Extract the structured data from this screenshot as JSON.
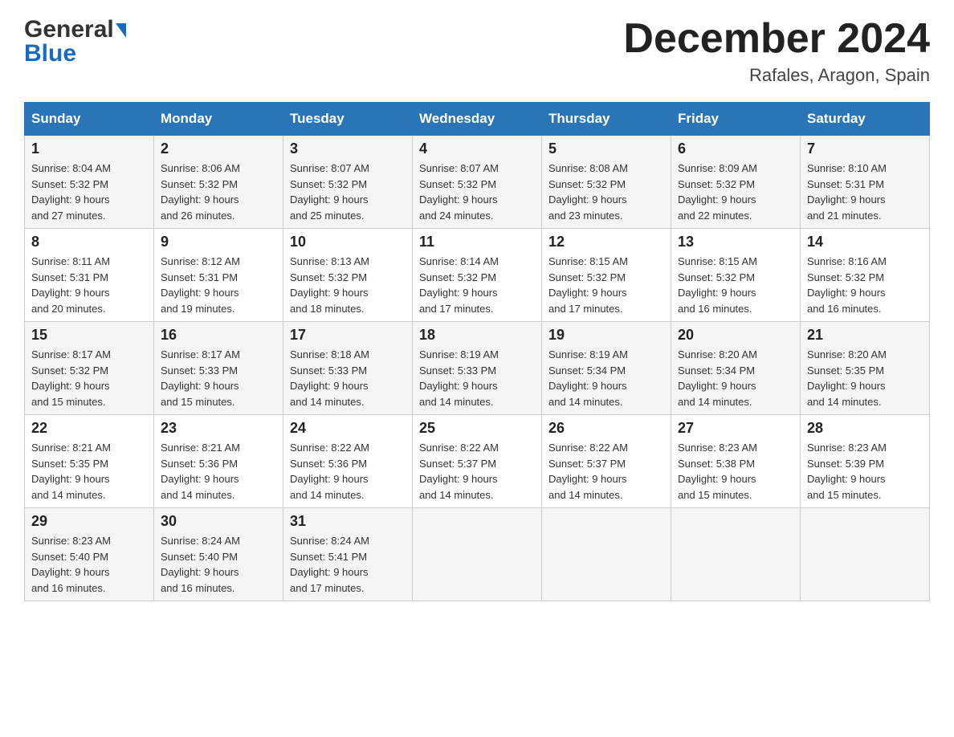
{
  "header": {
    "month_title": "December 2024",
    "location": "Rafales, Aragon, Spain",
    "logo_general": "General",
    "logo_blue": "Blue"
  },
  "days_of_week": [
    "Sunday",
    "Monday",
    "Tuesday",
    "Wednesday",
    "Thursday",
    "Friday",
    "Saturday"
  ],
  "weeks": [
    [
      {
        "day": "1",
        "sunrise": "8:04 AM",
        "sunset": "5:32 PM",
        "daylight": "9 hours and 27 minutes."
      },
      {
        "day": "2",
        "sunrise": "8:06 AM",
        "sunset": "5:32 PM",
        "daylight": "9 hours and 26 minutes."
      },
      {
        "day": "3",
        "sunrise": "8:07 AM",
        "sunset": "5:32 PM",
        "daylight": "9 hours and 25 minutes."
      },
      {
        "day": "4",
        "sunrise": "8:07 AM",
        "sunset": "5:32 PM",
        "daylight": "9 hours and 24 minutes."
      },
      {
        "day": "5",
        "sunrise": "8:08 AM",
        "sunset": "5:32 PM",
        "daylight": "9 hours and 23 minutes."
      },
      {
        "day": "6",
        "sunrise": "8:09 AM",
        "sunset": "5:32 PM",
        "daylight": "9 hours and 22 minutes."
      },
      {
        "day": "7",
        "sunrise": "8:10 AM",
        "sunset": "5:31 PM",
        "daylight": "9 hours and 21 minutes."
      }
    ],
    [
      {
        "day": "8",
        "sunrise": "8:11 AM",
        "sunset": "5:31 PM",
        "daylight": "9 hours and 20 minutes."
      },
      {
        "day": "9",
        "sunrise": "8:12 AM",
        "sunset": "5:31 PM",
        "daylight": "9 hours and 19 minutes."
      },
      {
        "day": "10",
        "sunrise": "8:13 AM",
        "sunset": "5:32 PM",
        "daylight": "9 hours and 18 minutes."
      },
      {
        "day": "11",
        "sunrise": "8:14 AM",
        "sunset": "5:32 PM",
        "daylight": "9 hours and 17 minutes."
      },
      {
        "day": "12",
        "sunrise": "8:15 AM",
        "sunset": "5:32 PM",
        "daylight": "9 hours and 17 minutes."
      },
      {
        "day": "13",
        "sunrise": "8:15 AM",
        "sunset": "5:32 PM",
        "daylight": "9 hours and 16 minutes."
      },
      {
        "day": "14",
        "sunrise": "8:16 AM",
        "sunset": "5:32 PM",
        "daylight": "9 hours and 16 minutes."
      }
    ],
    [
      {
        "day": "15",
        "sunrise": "8:17 AM",
        "sunset": "5:32 PM",
        "daylight": "9 hours and 15 minutes."
      },
      {
        "day": "16",
        "sunrise": "8:17 AM",
        "sunset": "5:33 PM",
        "daylight": "9 hours and 15 minutes."
      },
      {
        "day": "17",
        "sunrise": "8:18 AM",
        "sunset": "5:33 PM",
        "daylight": "9 hours and 14 minutes."
      },
      {
        "day": "18",
        "sunrise": "8:19 AM",
        "sunset": "5:33 PM",
        "daylight": "9 hours and 14 minutes."
      },
      {
        "day": "19",
        "sunrise": "8:19 AM",
        "sunset": "5:34 PM",
        "daylight": "9 hours and 14 minutes."
      },
      {
        "day": "20",
        "sunrise": "8:20 AM",
        "sunset": "5:34 PM",
        "daylight": "9 hours and 14 minutes."
      },
      {
        "day": "21",
        "sunrise": "8:20 AM",
        "sunset": "5:35 PM",
        "daylight": "9 hours and 14 minutes."
      }
    ],
    [
      {
        "day": "22",
        "sunrise": "8:21 AM",
        "sunset": "5:35 PM",
        "daylight": "9 hours and 14 minutes."
      },
      {
        "day": "23",
        "sunrise": "8:21 AM",
        "sunset": "5:36 PM",
        "daylight": "9 hours and 14 minutes."
      },
      {
        "day": "24",
        "sunrise": "8:22 AM",
        "sunset": "5:36 PM",
        "daylight": "9 hours and 14 minutes."
      },
      {
        "day": "25",
        "sunrise": "8:22 AM",
        "sunset": "5:37 PM",
        "daylight": "9 hours and 14 minutes."
      },
      {
        "day": "26",
        "sunrise": "8:22 AM",
        "sunset": "5:37 PM",
        "daylight": "9 hours and 14 minutes."
      },
      {
        "day": "27",
        "sunrise": "8:23 AM",
        "sunset": "5:38 PM",
        "daylight": "9 hours and 15 minutes."
      },
      {
        "day": "28",
        "sunrise": "8:23 AM",
        "sunset": "5:39 PM",
        "daylight": "9 hours and 15 minutes."
      }
    ],
    [
      {
        "day": "29",
        "sunrise": "8:23 AM",
        "sunset": "5:40 PM",
        "daylight": "9 hours and 16 minutes."
      },
      {
        "day": "30",
        "sunrise": "8:24 AM",
        "sunset": "5:40 PM",
        "daylight": "9 hours and 16 minutes."
      },
      {
        "day": "31",
        "sunrise": "8:24 AM",
        "sunset": "5:41 PM",
        "daylight": "9 hours and 17 minutes."
      },
      null,
      null,
      null,
      null
    ]
  ],
  "labels": {
    "sunrise": "Sunrise:",
    "sunset": "Sunset:",
    "daylight": "Daylight:"
  }
}
